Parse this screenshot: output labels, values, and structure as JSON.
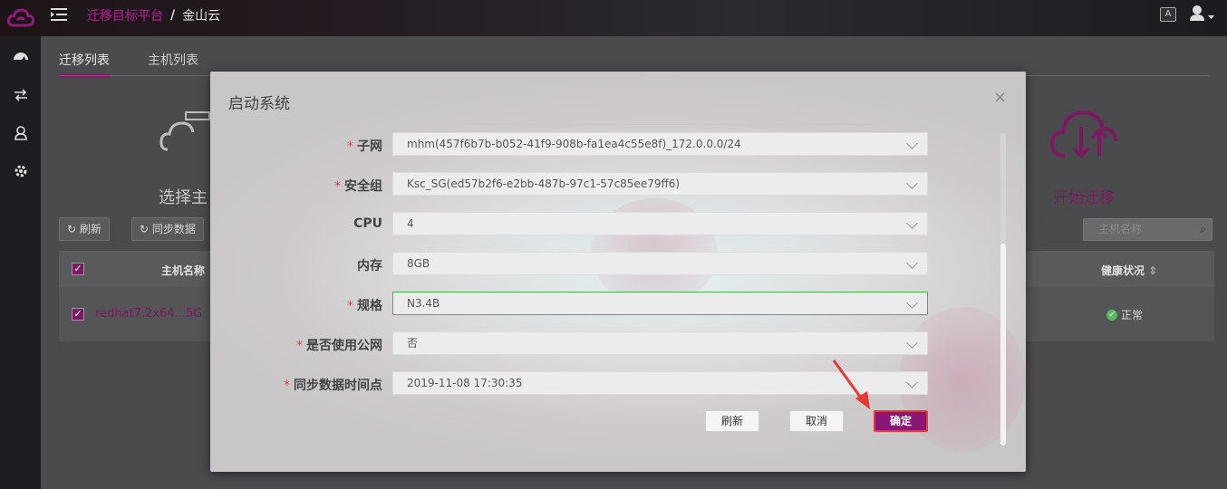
{
  "header": {
    "breadcrumb_platform": "迁移目标平台",
    "breadcrumb_separator": "/",
    "breadcrumb_cloud": "金山云",
    "lang_badge": "A",
    "icons": [
      "cloud-logo-icon",
      "menu-toggle-icon",
      "language-icon",
      "user-icon",
      "chevron-down-icon"
    ]
  },
  "sidebar": {
    "icons": [
      "dashboard-icon",
      "migrate-icon",
      "user-icon",
      "settings-icon"
    ]
  },
  "main": {
    "tabs": [
      "迁移列表",
      "主机列表"
    ],
    "active_tab": 0,
    "step_left_label": "选择主",
    "step_right_label": "开始迁移",
    "toolbar": {
      "refresh": "刷新",
      "sync": "同步数据",
      "search_placeholder": "主机名称"
    },
    "table": {
      "headers": [
        "主机名称",
        "健康状况"
      ],
      "rows": [
        {
          "name": "redhat7.2x64...5G",
          "health": "正常"
        }
      ]
    }
  },
  "modal": {
    "title": "启动系统",
    "close_label": "×",
    "fields": [
      {
        "label": "子网",
        "required": true,
        "value": "mhm(457f6b7b-b052-41f9-908b-fa1ea4c55e8f)_172.0.0.0/24"
      },
      {
        "label": "安全组",
        "required": true,
        "value": "Ksc_SG(ed57b2f6-e2bb-487b-97c1-57c85ee79ff6)"
      },
      {
        "label": "CPU",
        "required": false,
        "value": "4"
      },
      {
        "label": "内存",
        "required": false,
        "value": "8GB"
      },
      {
        "label": "规格",
        "required": true,
        "value": "N3.4B"
      },
      {
        "label": "是否使用公网",
        "required": true,
        "value": "否"
      },
      {
        "label": "同步数据时间点",
        "required": true,
        "value": "2019-11-08 17:30:35"
      }
    ],
    "buttons": {
      "refresh": "刷新",
      "cancel": "取消",
      "confirm": "确定"
    }
  },
  "colors": {
    "brand": "#8a1676",
    "annotation": "#e53935",
    "focus_border": "#4cae4c",
    "required": "#d94a4a"
  }
}
